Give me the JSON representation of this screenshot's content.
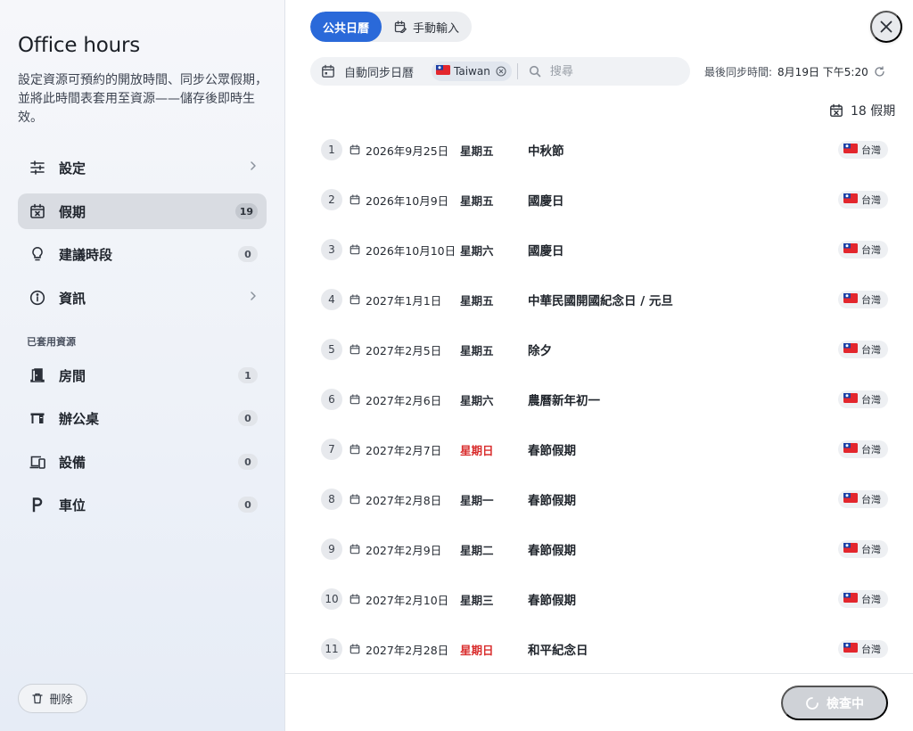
{
  "sidebar": {
    "title": "Office hours",
    "description": "設定資源可預約的開放時間、同步公眾假期，並將此時間表套用至資源——儲存後即時生效。",
    "items": [
      {
        "label": "設定"
      },
      {
        "label": "假期",
        "count": "19"
      },
      {
        "label": "建議時段",
        "count": "0"
      },
      {
        "label": "資訊"
      }
    ],
    "section_label": "已套用資源",
    "resources": [
      {
        "label": "房間",
        "count": "1"
      },
      {
        "label": "辦公桌",
        "count": "0"
      },
      {
        "label": "設備",
        "count": "0"
      },
      {
        "label": "車位",
        "count": "0"
      }
    ],
    "delete_label": "刪除"
  },
  "header": {
    "tabs": [
      {
        "label": "公共日曆",
        "active": true
      },
      {
        "label": "手動輸入",
        "active": false
      }
    ]
  },
  "filter": {
    "auto_sync_label": "自動同步日曆",
    "chip_label": "Taiwan",
    "search_placeholder": "搜尋"
  },
  "sync": {
    "label": "最後同步時間:",
    "value": "8月19日 下午5:20"
  },
  "holiday_count_label": "18 假期",
  "holidays": [
    {
      "num": "1",
      "date": "2026年9月25日",
      "weekday": "星期五",
      "name": "中秋節",
      "region": "台灣",
      "sunday": false
    },
    {
      "num": "2",
      "date": "2026年10月9日",
      "weekday": "星期五",
      "name": "國慶日",
      "region": "台灣",
      "sunday": false
    },
    {
      "num": "3",
      "date": "2026年10月10日",
      "weekday": "星期六",
      "name": "國慶日",
      "region": "台灣",
      "sunday": false
    },
    {
      "num": "4",
      "date": "2027年1月1日",
      "weekday": "星期五",
      "name": "中華民國開國紀念日 / 元旦",
      "region": "台灣",
      "sunday": false
    },
    {
      "num": "5",
      "date": "2027年2月5日",
      "weekday": "星期五",
      "name": "除夕",
      "region": "台灣",
      "sunday": false
    },
    {
      "num": "6",
      "date": "2027年2月6日",
      "weekday": "星期六",
      "name": "農曆新年初一",
      "region": "台灣",
      "sunday": false
    },
    {
      "num": "7",
      "date": "2027年2月7日",
      "weekday": "星期日",
      "name": "春節假期",
      "region": "台灣",
      "sunday": true
    },
    {
      "num": "8",
      "date": "2027年2月8日",
      "weekday": "星期一",
      "name": "春節假期",
      "region": "台灣",
      "sunday": false
    },
    {
      "num": "9",
      "date": "2027年2月9日",
      "weekday": "星期二",
      "name": "春節假期",
      "region": "台灣",
      "sunday": false
    },
    {
      "num": "10",
      "date": "2027年2月10日",
      "weekday": "星期三",
      "name": "春節假期",
      "region": "台灣",
      "sunday": false
    },
    {
      "num": "11",
      "date": "2027年2月28日",
      "weekday": "星期日",
      "name": "和平紀念日",
      "region": "台灣",
      "sunday": true
    }
  ],
  "footer": {
    "check_label": "檢查中"
  },
  "colors": {
    "accent": "#2a69d9",
    "sunday": "#d92d2d"
  }
}
